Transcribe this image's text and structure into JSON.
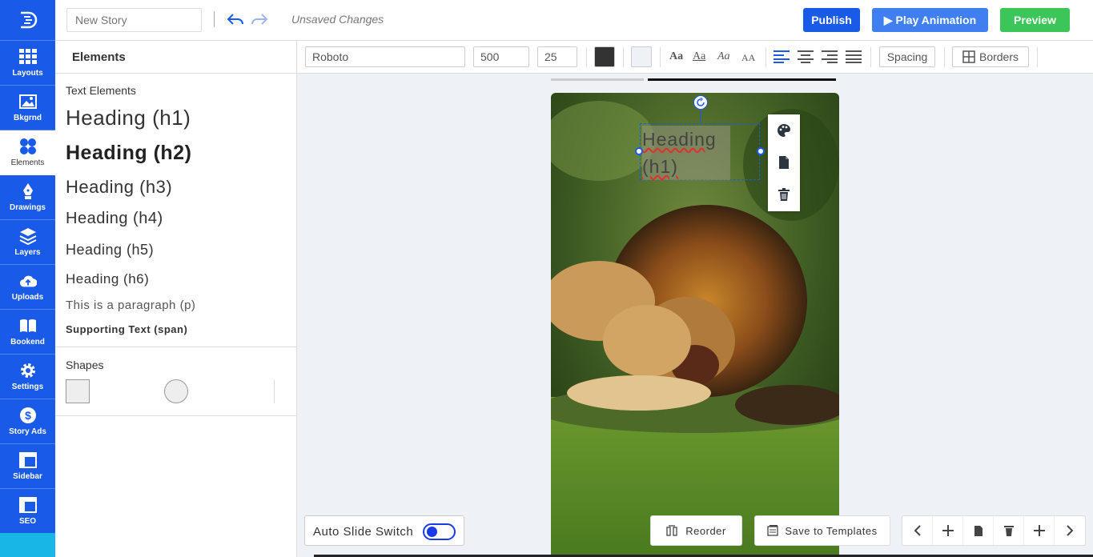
{
  "rail": {
    "items": [
      {
        "label": "Layouts",
        "icon": "grid-icon"
      },
      {
        "label": "Bkgrnd",
        "icon": "image-icon"
      },
      {
        "label": "Elements",
        "icon": "shapes-icon"
      },
      {
        "label": "Drawings",
        "icon": "pen-icon"
      },
      {
        "label": "Layers",
        "icon": "layers-icon"
      },
      {
        "label": "Uploads",
        "icon": "cloud-upload-icon"
      },
      {
        "label": "Bookend",
        "icon": "book-icon"
      },
      {
        "label": "Settings",
        "icon": "gear-icon"
      },
      {
        "label": "Story Ads",
        "icon": "dollar-icon"
      },
      {
        "label": "Sidebar",
        "icon": "sidebar-icon"
      },
      {
        "label": "SEO",
        "icon": "seo-icon"
      }
    ],
    "active": "Elements"
  },
  "topbar": {
    "story_placeholder": "New Story",
    "status": "Unsaved Changes",
    "publish": "Publish",
    "play": "▶ Play Animation",
    "preview": "Preview"
  },
  "panel": {
    "title": "Elements",
    "text_section": "Text Elements",
    "h1": "Heading (h1)",
    "h2": "Heading (h2)",
    "h3": "Heading (h3)",
    "h4": "Heading (h4)",
    "h5": "Heading (h5)",
    "h6": "Heading (h6)",
    "p": "This is a paragraph (p)",
    "span": "Supporting Text (span)",
    "shapes_section": "Shapes"
  },
  "format": {
    "font": "Roboto",
    "weight": "500",
    "size": "25",
    "text_color": "#333333",
    "bg_color": "#eef1f6",
    "case_options": [
      "Aa",
      "Aa",
      "Aa",
      "AA"
    ],
    "spacing": "Spacing",
    "borders": "Borders"
  },
  "canvas": {
    "selected_text": "Heading (h1)",
    "selected_word1": "Heading",
    "selected_word2": "(h1)"
  },
  "bottom": {
    "auto_slide": "Auto Slide Switch",
    "reorder": "Reorder",
    "save_templates": "Save to Templates"
  },
  "colors": {
    "primary": "#1a5ae8",
    "play": "#3f7ff0",
    "preview": "#3cc65a"
  }
}
